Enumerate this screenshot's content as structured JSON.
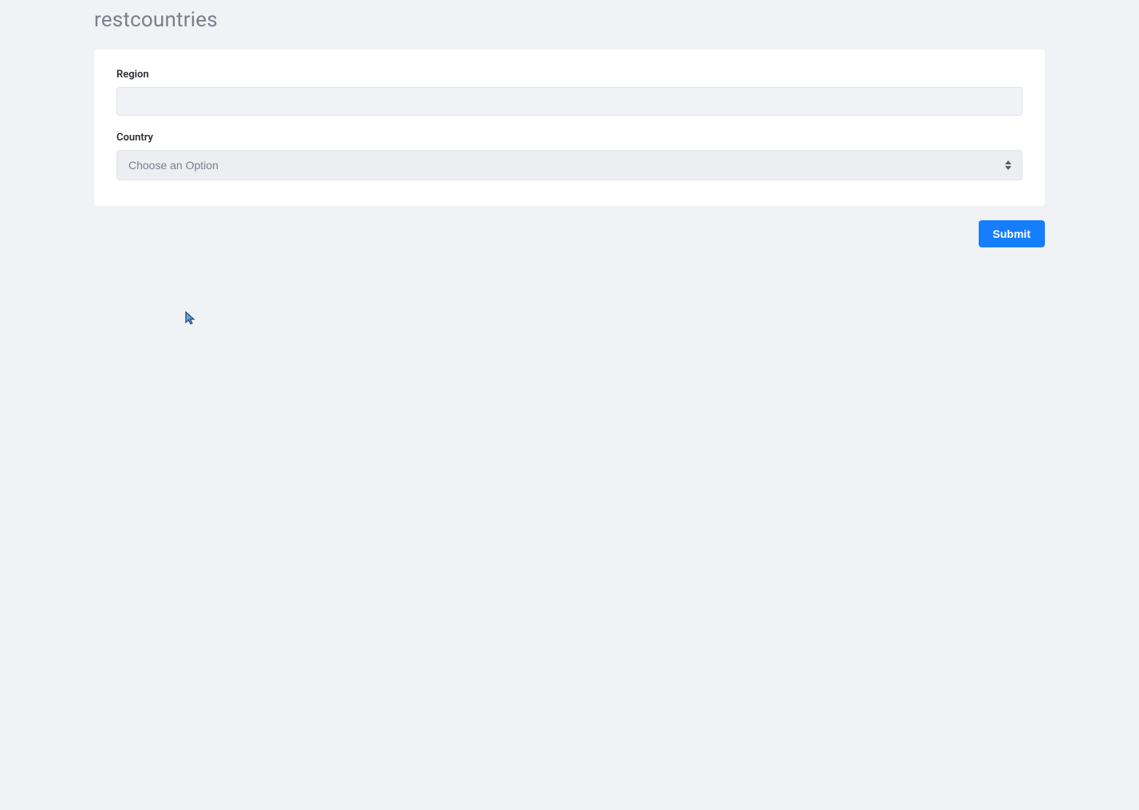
{
  "header": {
    "title": "restcountries"
  },
  "form": {
    "region": {
      "label": "Region",
      "value": ""
    },
    "country": {
      "label": "Country",
      "placeholder": "Choose an Option"
    }
  },
  "actions": {
    "submit_label": "Submit"
  }
}
